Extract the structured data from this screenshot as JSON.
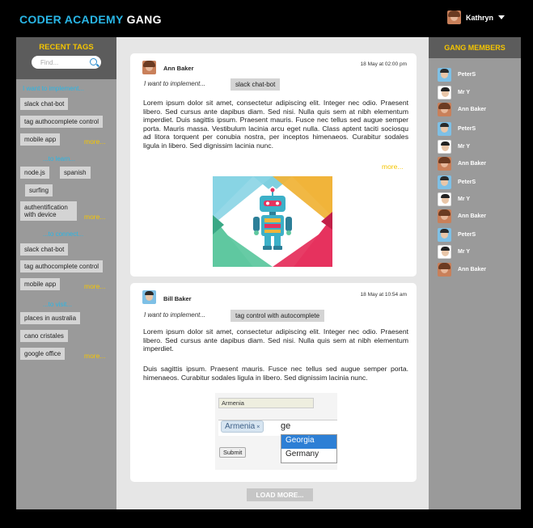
{
  "header": {
    "brand_part1": "CODER ACADEMY",
    "brand_part2": "GANG",
    "user_name": "Kathryn"
  },
  "left": {
    "title": "RECENT TAGS",
    "search_placeholder": "Find...",
    "sections": [
      {
        "heading": "I want to implement...",
        "tags": [
          "slack chat-bot",
          "tag authocomplete control",
          "mobile app"
        ],
        "more": "more..."
      },
      {
        "heading": "...to learn...",
        "tags": [
          "node.js",
          "spanish",
          "surfing",
          "authentification with device"
        ],
        "more": "more..."
      },
      {
        "heading": "...to connect...",
        "tags": [
          "slack chat-bot",
          "tag authocomplete control",
          "mobile app"
        ],
        "more": "more..."
      },
      {
        "heading": "...to visit...",
        "tags": [
          "places in australia",
          "cano cristales",
          "google office"
        ],
        "more": "more..."
      }
    ]
  },
  "posts": [
    {
      "author": "Ann Baker",
      "time": "18 May at 02:00 pm",
      "want": "I want to implement...",
      "chip": "slack chat-bot",
      "body": "Lorem ipsum dolor sit amet, consectetur adipiscing elit. Integer nec odio. Praesent libero. Sed cursus ante dapibus diam. Sed nisi. Nulla quis sem at nibh elementum imperdiet. Duis sagittis ipsum. Praesent mauris. Fusce nec tellus sed augue semper porta. Mauris massa. Vestibulum lacinia arcu eget nulla. Class aptent taciti sociosqu ad litora torquent per conubia nostra, per inceptos himenaeos. Curabitur sodales ligula in libero. Sed dignissim lacinia nunc.",
      "more": "more..."
    },
    {
      "author": "Bill Baker",
      "time": "18 May at 10:54 am",
      "want": "I want to implement...",
      "chip": "tag control with autocomplete",
      "body1": "Lorem ipsum dolor sit amet, consectetur adipiscing elit. Integer nec odio. Praesent libero. Sed cursus ante dapibus diam. Sed nisi. Nulla quis sem at nibh elementum imperdiet.",
      "body2": "Duis sagittis ipsum. Praesent mauris. Fusce nec tellus sed augue semper porta. himenaeos. Curabitur sodales ligula in libero. Sed dignissim lacinia nunc.",
      "demo": {
        "input_value": "Armenia",
        "token": "Armenia",
        "token_remove": "×",
        "typed": "ge",
        "options": [
          "Georgia",
          "Germany"
        ],
        "submit": "Submit"
      }
    }
  ],
  "load_more": "LOAD MORE...",
  "right": {
    "title": "GANG MEMBERS",
    "members": [
      {
        "name": "PeterS",
        "avatar": "m"
      },
      {
        "name": "Mr Y",
        "avatar": "m2"
      },
      {
        "name": "Ann Baker",
        "avatar": "f"
      },
      {
        "name": "PeterS",
        "avatar": "m"
      },
      {
        "name": "Mr Y",
        "avatar": "m2"
      },
      {
        "name": "Ann Baker",
        "avatar": "f"
      },
      {
        "name": "PeterS",
        "avatar": "m"
      },
      {
        "name": "Mr Y",
        "avatar": "m2"
      },
      {
        "name": "Ann Baker",
        "avatar": "f"
      },
      {
        "name": "PeterS",
        "avatar": "m"
      },
      {
        "name": "Mr Y",
        "avatar": "m2"
      },
      {
        "name": "Ann Baker",
        "avatar": "f"
      }
    ]
  },
  "colors": {
    "accent_blue": "#29b6e6",
    "accent_yellow": "#f5c500",
    "panel_gray": "#9a9a9a",
    "header_gray": "#5c5c5c"
  }
}
